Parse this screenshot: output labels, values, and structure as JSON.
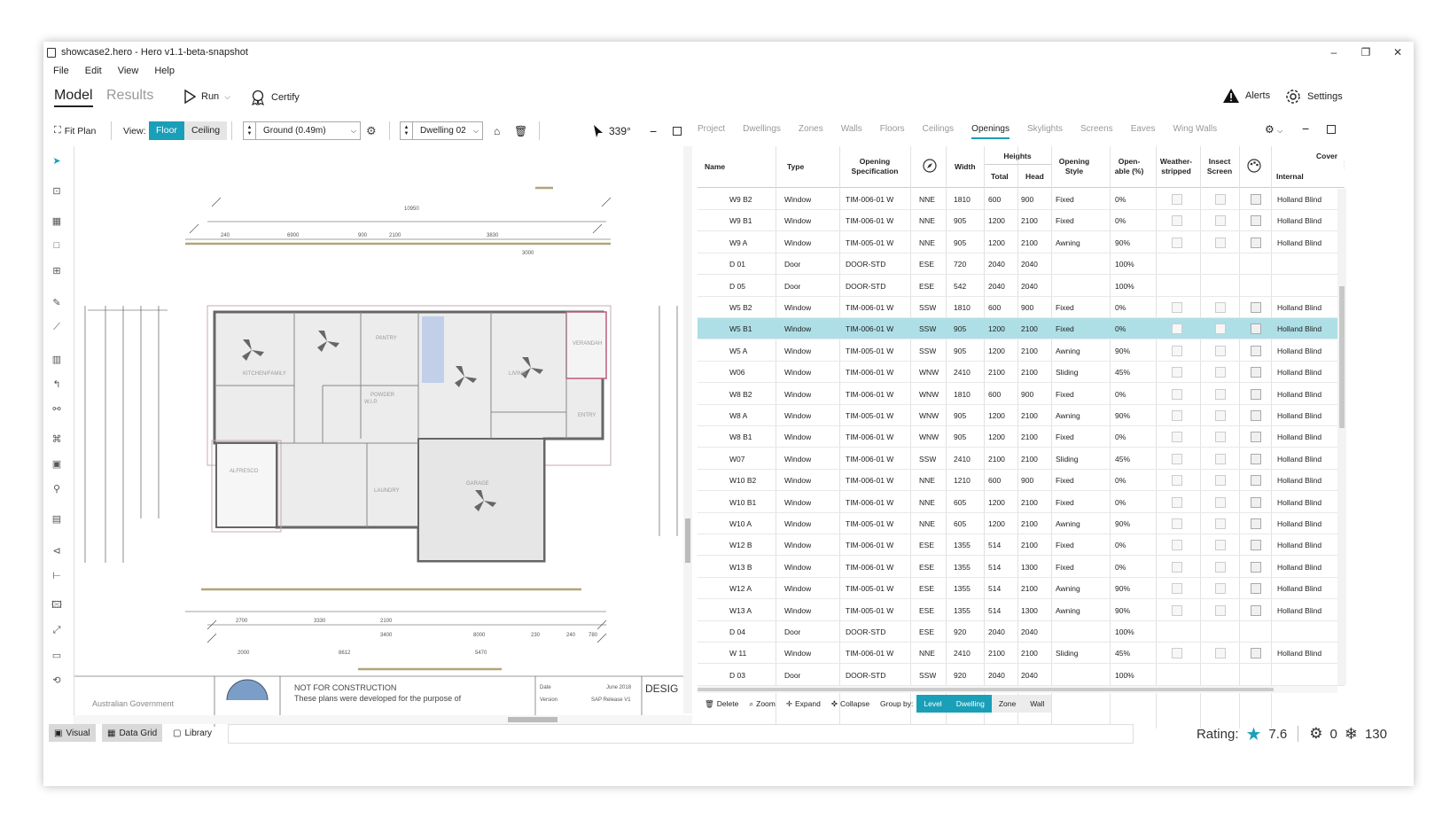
{
  "window": {
    "title": "showcase2.hero - Hero v1.1-beta-snapshot",
    "controls": [
      "–",
      "❐",
      "✕"
    ]
  },
  "menu": [
    "File",
    "Edit",
    "View",
    "Help"
  ],
  "toolbar": {
    "tab_model": "Model",
    "tab_results": "Results",
    "run_label": "Run",
    "certify_label": "Certify",
    "alerts_label": "Alerts",
    "settings_label": "Settings"
  },
  "view_toolbar": {
    "fit_plan": "Fit Plan",
    "view_label": "View:",
    "floor": "Floor",
    "ceiling": "Ceiling",
    "level_value": "Ground (0.49m)",
    "dwelling_value": "Dwelling 02",
    "orientation": "339°"
  },
  "drawing": {
    "labels": [
      "KITCHEN/FAMILY",
      "PANTRY",
      "VERANDAH",
      "ALFRESCO",
      "LAUNDRY",
      "GARAGE",
      "W.I.P.",
      "POWDER",
      "ENTRY",
      "LIVING"
    ],
    "dims_top": [
      "10950",
      "6900",
      "2100",
      "900",
      "3830",
      "3000",
      "240"
    ],
    "dims_bottom": [
      "2700",
      "3330",
      "2100",
      "3400",
      "8000",
      "230",
      "240",
      "780",
      "2000",
      "8612",
      "5470"
    ],
    "title_block": {
      "gov": "Australian Government",
      "notice": "NOT FOR CONSTRUCTION",
      "notice_sub": "These plans were developed for the purpose of",
      "date_label": "Date",
      "date_value": "June 2018",
      "version_label": "Version",
      "version_value": "SAP Release V1",
      "design": "DESIG"
    }
  },
  "right_tabs": [
    "Project",
    "Dwellings",
    "Zones",
    "Walls",
    "Floors",
    "Ceilings",
    "Openings",
    "Skylights",
    "Screens",
    "Eaves",
    "Wing Walls"
  ],
  "right_active_tab": "Openings",
  "grid": {
    "headers": {
      "name": "Name",
      "type": "Type",
      "spec": "Opening Specification",
      "width": "Width",
      "heights": "Heights",
      "total": "Total",
      "head": "Head",
      "style": "Opening Style",
      "openable": "Open-able (%)",
      "weather": "Weather-stripped",
      "insect": "Insect Screen",
      "cover": "Cover",
      "internal": "Internal"
    },
    "rows": [
      [
        "W9 B2",
        "Window",
        "TIM-006-01 W",
        "NNE",
        "1810",
        "600",
        "900",
        "Fixed",
        "0%",
        "Holland Blind"
      ],
      [
        "W9 B1",
        "Window",
        "TIM-006-01 W",
        "NNE",
        "905",
        "1200",
        "2100",
        "Fixed",
        "0%",
        "Holland Blind"
      ],
      [
        "W9 A",
        "Window",
        "TIM-005-01 W",
        "NNE",
        "905",
        "1200",
        "2100",
        "Awning",
        "90%",
        "Holland Blind"
      ],
      [
        "D 01",
        "Door",
        "DOOR-STD",
        "ESE",
        "720",
        "2040",
        "2040",
        "",
        "100%",
        ""
      ],
      [
        "D 05",
        "Door",
        "DOOR-STD",
        "ESE",
        "542",
        "2040",
        "2040",
        "",
        "100%",
        ""
      ],
      [
        "W5 B2",
        "Window",
        "TIM-006-01 W",
        "SSW",
        "1810",
        "600",
        "900",
        "Fixed",
        "0%",
        "Holland Blind"
      ],
      [
        "W5 B1",
        "Window",
        "TIM-006-01 W",
        "SSW",
        "905",
        "1200",
        "2100",
        "Fixed",
        "0%",
        "Holland Blind"
      ],
      [
        "W5 A",
        "Window",
        "TIM-005-01 W",
        "SSW",
        "905",
        "1200",
        "2100",
        "Awning",
        "90%",
        "Holland Blind"
      ],
      [
        "W06",
        "Window",
        "TIM-006-01 W",
        "WNW",
        "2410",
        "2100",
        "2100",
        "Sliding",
        "45%",
        "Holland Blind"
      ],
      [
        "W8 B2",
        "Window",
        "TIM-006-01 W",
        "WNW",
        "1810",
        "600",
        "900",
        "Fixed",
        "0%",
        "Holland Blind"
      ],
      [
        "W8 A",
        "Window",
        "TIM-005-01 W",
        "WNW",
        "905",
        "1200",
        "2100",
        "Awning",
        "90%",
        "Holland Blind"
      ],
      [
        "W8 B1",
        "Window",
        "TIM-006-01 W",
        "WNW",
        "905",
        "1200",
        "2100",
        "Fixed",
        "0%",
        "Holland Blind"
      ],
      [
        "W07",
        "Window",
        "TIM-006-01 W",
        "SSW",
        "2410",
        "2100",
        "2100",
        "Sliding",
        "45%",
        "Holland Blind"
      ],
      [
        "W10 B2",
        "Window",
        "TIM-006-01 W",
        "NNE",
        "1210",
        "600",
        "900",
        "Fixed",
        "0%",
        "Holland Blind"
      ],
      [
        "W10 B1",
        "Window",
        "TIM-006-01 W",
        "NNE",
        "605",
        "1200",
        "2100",
        "Fixed",
        "0%",
        "Holland Blind"
      ],
      [
        "W10 A",
        "Window",
        "TIM-005-01 W",
        "NNE",
        "605",
        "1200",
        "2100",
        "Awning",
        "90%",
        "Holland Blind"
      ],
      [
        "W12 B",
        "Window",
        "TIM-006-01 W",
        "ESE",
        "1355",
        "514",
        "2100",
        "Fixed",
        "0%",
        "Holland Blind"
      ],
      [
        "W13 B",
        "Window",
        "TIM-006-01 W",
        "ESE",
        "1355",
        "514",
        "1300",
        "Fixed",
        "0%",
        "Holland Blind"
      ],
      [
        "W12 A",
        "Window",
        "TIM-005-01 W",
        "ESE",
        "1355",
        "514",
        "2100",
        "Awning",
        "90%",
        "Holland Blind"
      ],
      [
        "W13 A",
        "Window",
        "TIM-005-01 W",
        "ESE",
        "1355",
        "514",
        "1300",
        "Awning",
        "90%",
        "Holland Blind"
      ],
      [
        "D 04",
        "Door",
        "DOOR-STD",
        "ESE",
        "920",
        "2040",
        "2040",
        "",
        "100%",
        ""
      ],
      [
        "W 11",
        "Window",
        "TIM-006-01 W",
        "NNE",
        "2410",
        "2100",
        "2100",
        "Sliding",
        "45%",
        "Holland Blind"
      ],
      [
        "D 03",
        "Door",
        "DOOR-STD",
        "SSW",
        "920",
        "2040",
        "2040",
        "",
        "100%",
        ""
      ]
    ],
    "selected_index": 6
  },
  "grid_toolbar": {
    "delete": "Delete",
    "zoom": "Zoom",
    "expand": "Expand",
    "collapse": "Collapse",
    "group_by": "Group by:",
    "groups": [
      "Level",
      "Dwelling",
      "Zone",
      "Wall"
    ],
    "active_group": "Dwelling"
  },
  "statusbar": {
    "visual": "Visual",
    "data_grid": "Data Grid",
    "library": "Library",
    "rating_label": "Rating:",
    "rating_value": "7.6",
    "heating_value": "0",
    "cooling_value": "130"
  },
  "colors": {
    "accent": "#1a9fb8",
    "selected_row": "#aedfe6"
  }
}
